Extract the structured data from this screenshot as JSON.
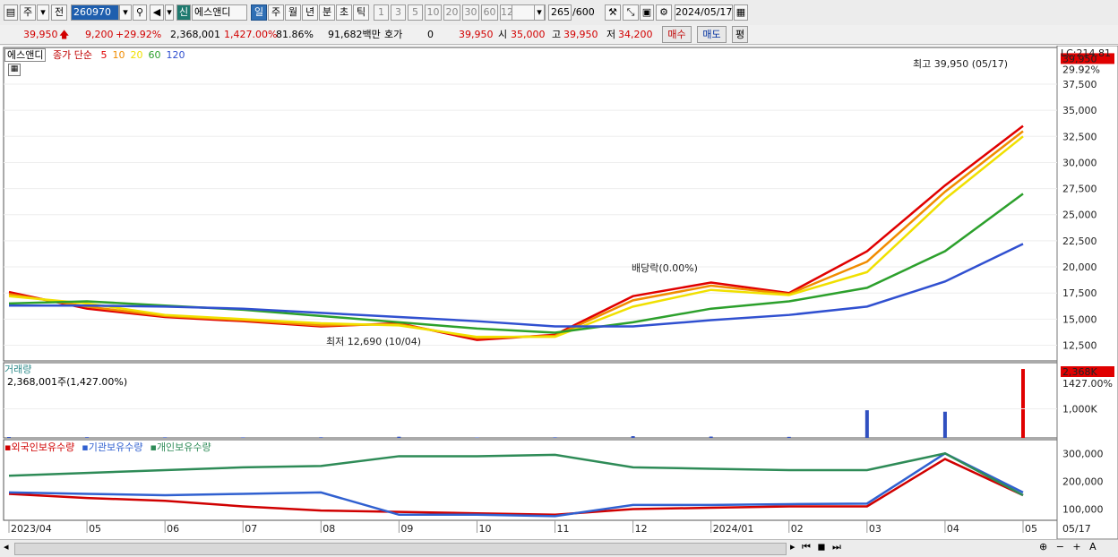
{
  "toolbar": {
    "period_code": "주",
    "prev_label": "전",
    "stock_code": "260970",
    "credit_badge": "신",
    "stock_name": "에스앤디",
    "tabs": [
      "일",
      "주",
      "월",
      "년",
      "분",
      "초",
      "틱"
    ],
    "periods": [
      "1",
      "3",
      "5",
      "10",
      "20",
      "30",
      "60",
      "120"
    ],
    "count": "265",
    "count_total": "/600",
    "date": "2024/05/17"
  },
  "info": {
    "price": "39,950",
    "change": "9,200",
    "change_pct": "+29.92%",
    "volume": "2,368,001",
    "volume_pct": "1,427.00%",
    "turnover": "81.86%",
    "amount": "91,682백만",
    "quote_label": "호가",
    "quote_value": "0",
    "quote_price": "39,950",
    "open_label": "시",
    "open": "35,000",
    "high_label": "고",
    "high": "39,950",
    "low_label": "저",
    "low": "34,200",
    "buy_label": "매수",
    "sell_label": "매도",
    "eval_label": "평"
  },
  "price_panel": {
    "stock_tag": "에스앤디",
    "ma_title": "종가 단순",
    "ma_periods": [
      "5",
      "10",
      "20",
      "60",
      "120"
    ],
    "ma_colors": [
      "#e00000",
      "#f08c00",
      "#f0e000",
      "#2ca02c",
      "#3050d0"
    ],
    "lc_label": "LC:214.81",
    "last_price_label": "39,950",
    "last_pct_label": "29.92%",
    "high_annotation": "최고 39,950 (05/17)",
    "low_annotation": "최저 12,690 (10/04)",
    "event_annotation": "배당락(0.00%)"
  },
  "volume_panel": {
    "title": "거래량",
    "subtitle": "2,368,001주(1,427.00%)",
    "last_label": "2,368K",
    "last_pct": "1427.00%",
    "tick": "1,000K"
  },
  "holdings_panel": {
    "series_labels": [
      "외국인보유수량",
      "기관보유수량",
      "개인보유수량"
    ],
    "series_colors": [
      "#d00000",
      "#3060d0",
      "#2e8b57"
    ],
    "ticks": [
      "300,000",
      "200,000",
      "100,000"
    ]
  },
  "x_axis": {
    "labels": [
      "2023/04",
      "05",
      "06",
      "07",
      "08",
      "09",
      "10",
      "11",
      "12",
      "2024/01",
      "02",
      "03",
      "04",
      "05"
    ],
    "right_label": "05/17"
  },
  "chart_data": [
    {
      "type": "line",
      "title": "",
      "xlabel": "",
      "ylabel": "",
      "x": [
        "2023/04",
        "2023/05",
        "2023/06",
        "2023/07",
        "2023/08",
        "2023/09",
        "2023/10",
        "2023/11",
        "2023/12",
        "2024/01",
        "2024/02",
        "2024/03",
        "2024/04",
        "2024/05/17"
      ],
      "ylim": [
        11000,
        40500
      ],
      "yticks": [
        12500,
        15000,
        17500,
        20000,
        22500,
        25000,
        27500,
        30000,
        32500,
        35000,
        37500
      ],
      "series": [
        {
          "name": "5",
          "values": [
            17600,
            16000,
            15200,
            14800,
            14300,
            14600,
            13000,
            13500,
            17200,
            18500,
            17500,
            21500,
            27800,
            33500
          ]
        },
        {
          "name": "10",
          "values": [
            17400,
            16200,
            15300,
            14900,
            14400,
            14500,
            13200,
            13400,
            16800,
            18200,
            17400,
            20500,
            27200,
            33000
          ]
        },
        {
          "name": "20",
          "values": [
            17200,
            16500,
            15400,
            15000,
            14600,
            14400,
            13300,
            13300,
            16200,
            17800,
            17300,
            19500,
            26500,
            32500
          ]
        },
        {
          "name": "60",
          "values": [
            16500,
            16700,
            16300,
            15900,
            15300,
            14700,
            14100,
            13700,
            14700,
            16000,
            16700,
            18000,
            21500,
            27000
          ]
        },
        {
          "name": "120",
          "values": [
            16300,
            16300,
            16200,
            16000,
            15600,
            15200,
            14800,
            14300,
            14300,
            14900,
            15400,
            16200,
            18600,
            22200
          ]
        }
      ]
    },
    {
      "type": "bar",
      "title": "",
      "x": [
        "2023/04",
        "2023/05",
        "2023/06",
        "2023/07",
        "2023/08",
        "2023/09",
        "2023/10",
        "2023/11",
        "2023/12",
        "2024/01",
        "2024/02",
        "2024/03",
        "2024/04",
        "2024/05/17"
      ],
      "ylim": [
        0,
        2400000
      ],
      "values": [
        30000,
        25000,
        20000,
        18000,
        22000,
        40000,
        15000,
        20000,
        60000,
        45000,
        35000,
        950000,
        900000,
        2368001
      ]
    },
    {
      "type": "line",
      "title": "",
      "x": [
        "2023/04",
        "2023/05",
        "2023/06",
        "2023/07",
        "2023/08",
        "2023/09",
        "2023/10",
        "2023/11",
        "2023/12",
        "2024/01",
        "2024/02",
        "2024/03",
        "2024/04",
        "2024/05/17"
      ],
      "ylim": [
        60000,
        330000
      ],
      "series": [
        {
          "name": "외국인보유수량",
          "values": [
            155000,
            140000,
            130000,
            110000,
            95000,
            90000,
            85000,
            80000,
            100000,
            105000,
            110000,
            110000,
            280000,
            150000
          ]
        },
        {
          "name": "기관보유수량",
          "values": [
            160000,
            155000,
            150000,
            155000,
            160000,
            80000,
            80000,
            75000,
            115000,
            115000,
            118000,
            120000,
            300000,
            160000
          ]
        },
        {
          "name": "개인보유수량",
          "values": [
            220000,
            230000,
            240000,
            250000,
            255000,
            290000,
            290000,
            295000,
            250000,
            245000,
            240000,
            240000,
            300000,
            150000
          ]
        }
      ]
    }
  ]
}
